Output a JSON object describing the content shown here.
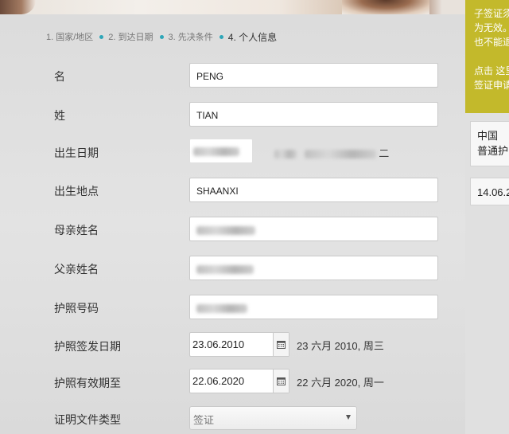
{
  "breadcrumb": [
    {
      "label": "1. 国家/地区"
    },
    {
      "label": "2. 到达日期"
    },
    {
      "label": "3. 先决条件"
    },
    {
      "label": "4. 个人信息"
    }
  ],
  "form": {
    "first_name": {
      "label": "名",
      "value": "PENG"
    },
    "last_name": {
      "label": "姓",
      "value": "TIAN"
    },
    "birth_date": {
      "label": "出生日期",
      "suffix": "二"
    },
    "birth_place": {
      "label": "出生地点",
      "value": "SHAANXI"
    },
    "mother_name": {
      "label": "母亲姓名"
    },
    "father_name": {
      "label": "父亲姓名"
    },
    "passport_no": {
      "label": "护照号码"
    },
    "issue_date": {
      "label": "护照签发日期",
      "value": "23.06.2010",
      "text": "23 六月 2010, 周三"
    },
    "expiry_date": {
      "label": "护照有效期至",
      "value": "22.06.2020",
      "text": "22 六月 2020, 周一"
    },
    "doc_type": {
      "label": "证明文件类型",
      "value": "签证"
    }
  },
  "sidebar": {
    "notice_lines": [
      "子签证须",
      "为无效。",
      "也不能退",
      "",
      "点击 这里",
      "签证申请"
    ],
    "country": "中国",
    "passport_type": "普通护",
    "date": "14.06.2"
  },
  "colors": {
    "accent": "#2ea6b8",
    "notice": "#c3b92b"
  }
}
